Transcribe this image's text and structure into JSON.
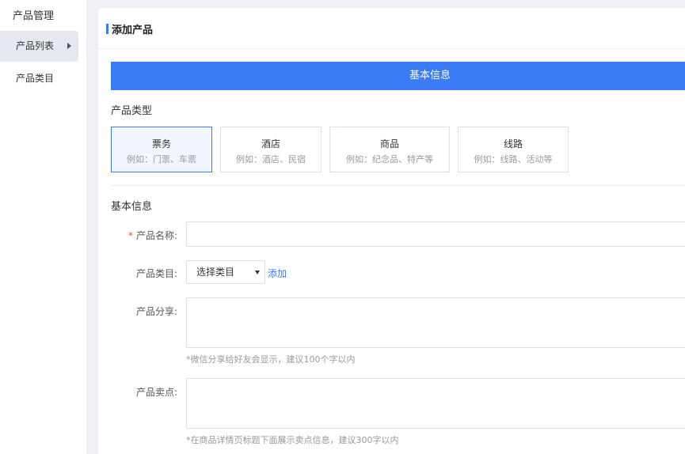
{
  "sidebar": {
    "title": "产品管理",
    "items": [
      {
        "label": "产品列表",
        "active": true
      },
      {
        "label": "产品类目",
        "active": false
      }
    ]
  },
  "panel": {
    "title": "添加产品",
    "banner": "基本信息",
    "product_type_heading": "产品类型",
    "product_types": [
      {
        "name": "票务",
        "desc": "例如：门票、车票",
        "selected": true
      },
      {
        "name": "酒店",
        "desc": "例如：酒店、民宿",
        "selected": false
      },
      {
        "name": "商品",
        "desc": "例如：纪念品、特产等",
        "selected": false
      },
      {
        "name": "线路",
        "desc": "例如：线路、活动等",
        "selected": false
      }
    ],
    "basic_info_heading": "基本信息",
    "fields": {
      "name": {
        "label": "产品名称:",
        "required_mark": "*",
        "value": ""
      },
      "category": {
        "label": "产品类目:",
        "selected": "选择类目",
        "add_link": "添加"
      },
      "share": {
        "label": "产品分享:",
        "value": "",
        "hint": "*微信分享给好友会显示，建议100个字以内"
      },
      "selling_point": {
        "label": "产品卖点:",
        "value": "",
        "hint": "*在商品详情页标题下面展示卖点信息，建议300字以内"
      }
    }
  },
  "colors": {
    "accent": "#3a7bf6",
    "required": "#e2502c"
  }
}
